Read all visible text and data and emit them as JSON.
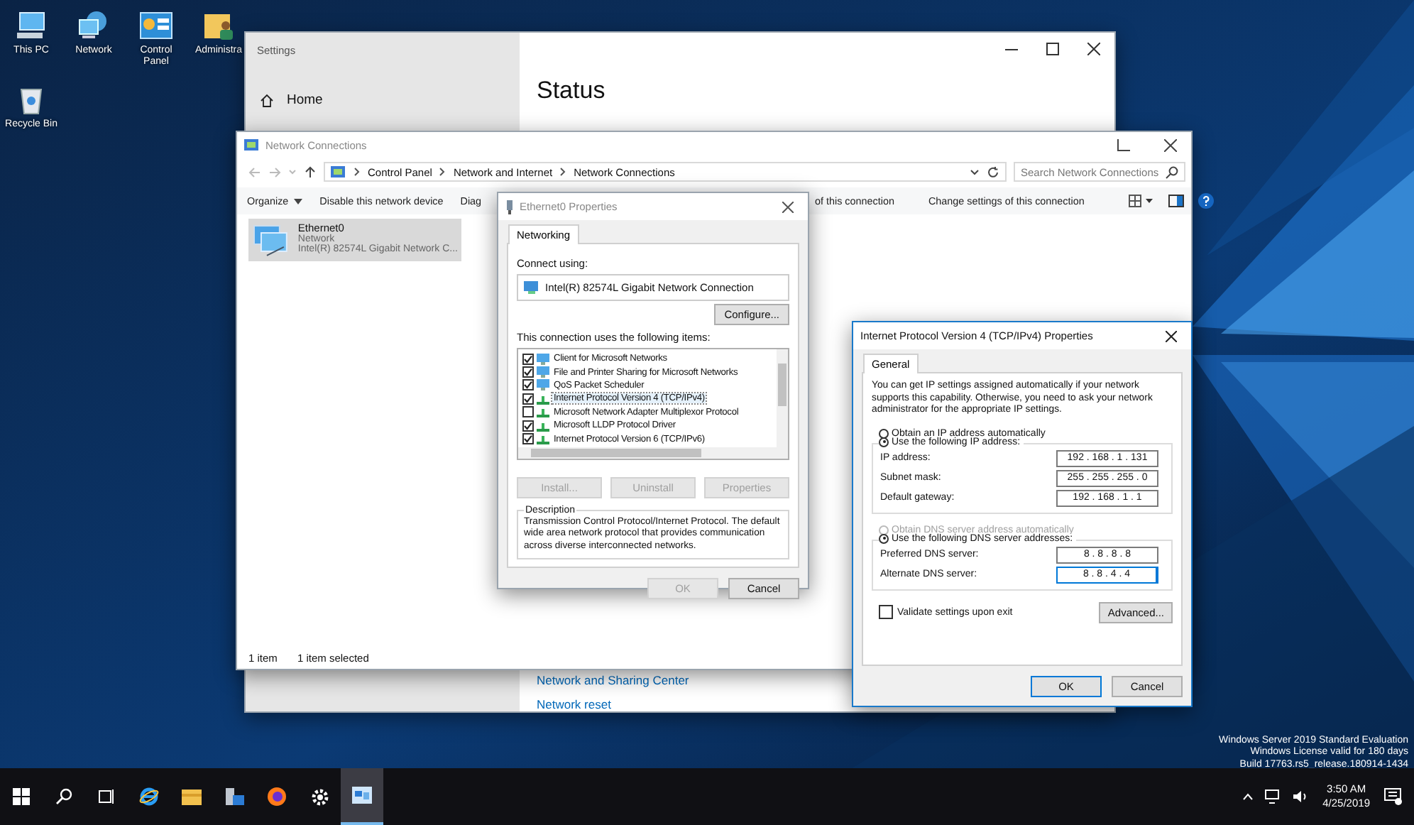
{
  "desktop_icons": [
    {
      "label": "This PC",
      "kind": "pc"
    },
    {
      "label": "Network",
      "kind": "network"
    },
    {
      "label": "Control Panel",
      "kind": "control_panel"
    },
    {
      "label": "Administra",
      "kind": "folder"
    },
    {
      "label": "Recycle Bin",
      "kind": "recycle"
    }
  ],
  "settings_window": {
    "title": "Settings",
    "active": false,
    "home": "Home",
    "heading": "Status",
    "links": [
      "Network and Sharing Center",
      "Network reset"
    ]
  },
  "network_connections": {
    "title": "Network Connections",
    "active": false,
    "breadcrumb": [
      "Control Panel",
      "Network and Internet",
      "Network Connections"
    ],
    "search": {
      "placeholder": "Search Network Connections"
    },
    "toolbar_left": [
      {
        "label": "Organize",
        "kind": "menu"
      },
      {
        "label": "Disable this network device",
        "kind": "command"
      },
      {
        "label": "Diag",
        "kind": "command"
      }
    ],
    "toolbar_right": [
      {
        "label": "of this connection"
      },
      {
        "label": "Change settings of this connection"
      }
    ],
    "connections": [
      {
        "name": "Ethernet0",
        "network": "Network",
        "device": "Intel(R) 82574L Gigabit Network C...",
        "selected": true
      }
    ],
    "status_bar": [
      "1 item",
      "1 item selected"
    ]
  },
  "ethernet_properties": {
    "title": "Ethernet0 Properties",
    "active": false,
    "tabs": [
      {
        "label": "Networking",
        "selected": true
      }
    ],
    "connect_label": "Connect using:",
    "adapter": "Intel(R) 82574L Gigabit Network Connection",
    "configure_button": "Configure...",
    "items_label": "This connection uses the following items:",
    "items": [
      {
        "label": "Client for Microsoft Networks",
        "kind": "client",
        "checked": true,
        "selected": false
      },
      {
        "label": "File and Printer Sharing for Microsoft Networks",
        "kind": "client",
        "checked": true,
        "selected": false
      },
      {
        "label": "QoS Packet Scheduler",
        "kind": "client",
        "checked": true,
        "selected": false
      },
      {
        "label": "Internet Protocol Version 4 (TCP/IPv4)",
        "kind": "protocol",
        "checked": true,
        "selected": true
      },
      {
        "label": "Microsoft Network Adapter Multiplexor Protocol",
        "kind": "protocol",
        "checked": false,
        "selected": false
      },
      {
        "label": "Microsoft LLDP Protocol Driver",
        "kind": "protocol",
        "checked": true,
        "selected": false
      },
      {
        "label": "Internet Protocol Version 6 (TCP/IPv6)",
        "kind": "protocol",
        "checked": true,
        "selected": false
      }
    ],
    "buttons": [
      {
        "label": "Install...",
        "disabled": true
      },
      {
        "label": "Uninstall",
        "disabled": true
      },
      {
        "label": "Properties",
        "disabled": true
      }
    ],
    "description_title": "Description",
    "description": "Transmission Control Protocol/Internet Protocol. The default wide area network protocol that provides communication across diverse interconnected networks.",
    "footer_buttons": [
      {
        "label": "OK",
        "disabled": true
      },
      {
        "label": "Cancel",
        "disabled": false
      }
    ]
  },
  "ipv4_properties": {
    "title": "Internet Protocol Version 4 (TCP/IPv4) Properties",
    "active": true,
    "tabs": [
      {
        "label": "General",
        "selected": true
      }
    ],
    "intro": "You can get IP settings assigned automatically if your network supports this capability. Otherwise, you need to ask your network administrator for the appropriate IP settings.",
    "ip_radios": [
      {
        "label": "Obtain an IP address automatically",
        "selected": false,
        "disabled": false
      },
      {
        "label": "Use the following IP address:",
        "selected": true,
        "disabled": false
      }
    ],
    "ip_fields": [
      {
        "label": "IP address:",
        "value": "192 . 168 . 1 . 131",
        "focused": false
      },
      {
        "label": "Subnet mask:",
        "value": "255 . 255 . 255 . 0",
        "focused": false
      },
      {
        "label": "Default gateway:",
        "value": "192 . 168 . 1 . 1",
        "focused": false
      }
    ],
    "dns_radios": [
      {
        "label": "Obtain DNS server address automatically",
        "selected": false,
        "disabled": true
      },
      {
        "label": "Use the following DNS server addresses:",
        "selected": true,
        "disabled": false
      }
    ],
    "dns_fields": [
      {
        "label": "Preferred DNS server:",
        "value": "8 . 8 . 8 . 8",
        "focused": false
      },
      {
        "label": "Alternate DNS server:",
        "value": "8 . 8 . 4 . 4",
        "focused": true
      }
    ],
    "validate": {
      "label": "Validate settings upon exit",
      "checked": false
    },
    "advanced_button": "Advanced...",
    "footer_buttons": [
      {
        "label": "OK",
        "default": true
      },
      {
        "label": "Cancel",
        "default": false
      }
    ]
  },
  "edition_notice": [
    "Windows Server 2019 Standard Evaluation",
    "Windows License valid for 180 days",
    "Build 17763.rs5_release.180914-1434"
  ],
  "taskbar": {
    "apps": [
      {
        "kind": "start",
        "active": false
      },
      {
        "kind": "search",
        "active": false
      },
      {
        "kind": "task_view",
        "active": false
      },
      {
        "kind": "ie",
        "active": false
      },
      {
        "kind": "explorer",
        "active": false
      },
      {
        "kind": "server_manager",
        "active": false
      },
      {
        "kind": "firefox",
        "active": false
      },
      {
        "kind": "settings",
        "active": false
      },
      {
        "kind": "network_connections",
        "active": true
      }
    ],
    "time": "3:50 AM",
    "date": "4/25/2019"
  }
}
